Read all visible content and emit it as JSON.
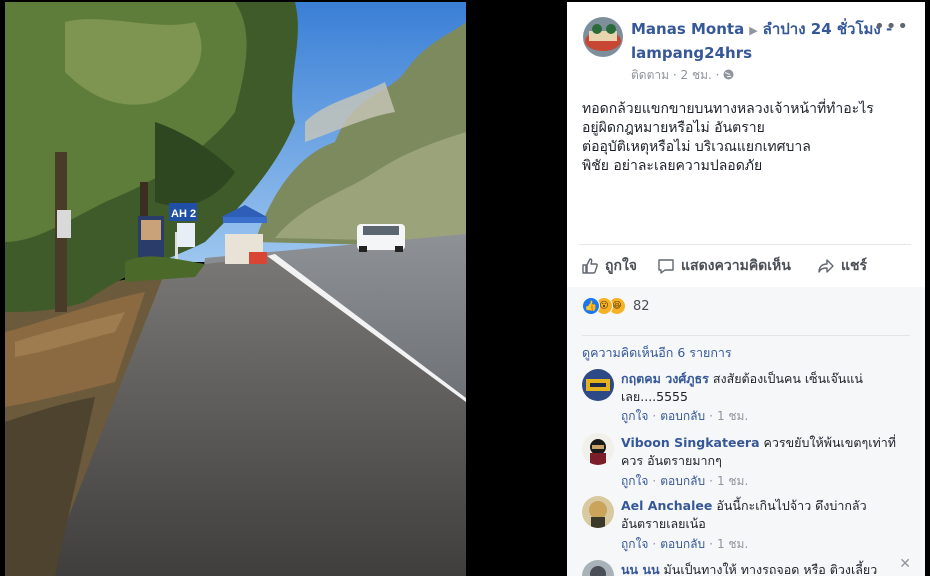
{
  "post": {
    "author": "Manas Monta",
    "group": "ลำปาง 24 ชั่วโมง - lampang24hrs",
    "follow": "ติดตาม",
    "time": "2 ชม.",
    "text_lines": [
      "ทอดกล้วยแขกขายบนทางหลวงเจ้าหน้าที่ทำอะไร",
      "อยู่ผิดกฎหมายหรือไม่ อันตราย",
      "ต่ออุบัติเหตุหรือไม่ บริเวณแยกเทศบาล",
      "พิชัย อย่าละเลยความปลอดภัย"
    ]
  },
  "actions": {
    "like": "ถูกใจ",
    "comment": "แสดงความคิดเห็น",
    "share": "แชร์"
  },
  "reactions": {
    "count": "82"
  },
  "more_comments": "ดูความคิดเห็นอีก 6 รายการ",
  "comment_actions": {
    "like": "ถูกใจ",
    "reply": "ตอบกลับ",
    "separator": "·"
  },
  "comments": [
    {
      "author": "กฤตคม วงศ์ภูธร",
      "text": "สงสัยต้องเป็นคน เซ็นเจ๊นแน่เลย....5555",
      "time": "1 ชม."
    },
    {
      "author": "Viboon Singkateera",
      "text": "ควรขยับให้พ้นเขตๆเท่าที่ควร อันตรายมากๆ",
      "time": "1 ชม."
    },
    {
      "author": "Ael Anchalee",
      "text": "อันนี้กะเกินไปจ้าว ดึงบ่ากลัวอันตรายเลยเน้อ",
      "time": "1 ชม."
    },
    {
      "author": "นน นน",
      "text": "มันเป็นทางให้ ทางรถจอด หรือ ติวงเลี้ยว"
    }
  ],
  "photo": {
    "sign_text": "AH 2"
  },
  "colors": {
    "link": "#365899",
    "meta": "#90949c",
    "like_blue": "#1877f2",
    "comments_bg": "#f6f7f9"
  }
}
